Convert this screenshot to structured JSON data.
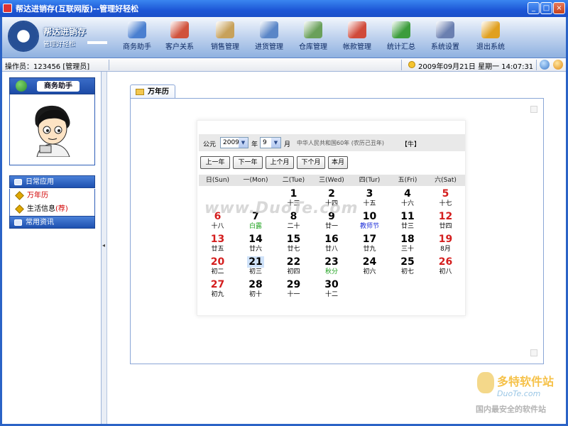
{
  "window": {
    "title": "帮达进销存(互联网版)--管理好轻松",
    "controls": [
      "minimize",
      "maximize",
      "close"
    ]
  },
  "brand": {
    "name": "帮达进销存",
    "slogan": "管理好轻松"
  },
  "toolbar": [
    {
      "label": "商务助手",
      "icon": "assistant-icon",
      "color": "#4a7fd0"
    },
    {
      "label": "客户关系",
      "icon": "customers-icon",
      "color": "#d0523c"
    },
    {
      "label": "销售管理",
      "icon": "sales-icon",
      "color": "#c7a15a"
    },
    {
      "label": "进货管理",
      "icon": "purchase-icon",
      "color": "#5a86c7"
    },
    {
      "label": "仓库管理",
      "icon": "warehouse-icon",
      "color": "#6aa05a"
    },
    {
      "label": "帐款管理",
      "icon": "accounts-icon",
      "color": "#d04a3a"
    },
    {
      "label": "统计汇总",
      "icon": "stats-icon",
      "color": "#3c9c3c"
    },
    {
      "label": "系统设置",
      "icon": "settings-icon",
      "color": "#6a7fb0"
    },
    {
      "label": "退出系统",
      "icon": "exit-icon",
      "color": "#e0a020"
    }
  ],
  "status": {
    "operator": "操作员：123456 [管理员]",
    "datetime": "2009年09月21日 星期一 14:07:31"
  },
  "sidebar": {
    "panel_title": "商务助手",
    "groups": [
      {
        "label": "日常应用",
        "items": [
          {
            "label": "万年历",
            "active": true
          },
          {
            "label": "生活信息",
            "tag": "(荐)"
          }
        ]
      },
      {
        "label": "常用资讯",
        "items": []
      }
    ]
  },
  "content": {
    "tab_label": "万年历",
    "calendar": {
      "prefix": "公元",
      "year": "2009",
      "year_unit": "年",
      "month": "9",
      "month_unit": "月",
      "info": "中华人民共和国60年 (农历己丑年)",
      "zodiac": "【牛】",
      "buttons": [
        "上一年",
        "下一年",
        "上个月",
        "下个月",
        "本月"
      ],
      "weekdays": [
        "日(Sun)",
        "一(Mon)",
        "二(Tue)",
        "三(Wed)",
        "四(Tur)",
        "五(Fri)",
        "六(Sat)"
      ],
      "days": [
        {
          "d": "1",
          "l": "十三"
        },
        {
          "d": "2",
          "l": "十四"
        },
        {
          "d": "3",
          "l": "十五"
        },
        {
          "d": "4",
          "l": "十六"
        },
        {
          "d": "5",
          "l": "十七"
        },
        {
          "d": "6",
          "l": "十八"
        },
        {
          "d": "7",
          "l": "白露"
        },
        {
          "d": "8",
          "l": "二十"
        },
        {
          "d": "9",
          "l": "廿一"
        },
        {
          "d": "10",
          "l": "教师节"
        },
        {
          "d": "11",
          "l": "廿三"
        },
        {
          "d": "12",
          "l": "廿四"
        },
        {
          "d": "13",
          "l": "廿五"
        },
        {
          "d": "14",
          "l": "廿六"
        },
        {
          "d": "15",
          "l": "廿七"
        },
        {
          "d": "16",
          "l": "廿八"
        },
        {
          "d": "17",
          "l": "廿九"
        },
        {
          "d": "18",
          "l": "三十"
        },
        {
          "d": "19",
          "l": "8月"
        },
        {
          "d": "20",
          "l": "初二"
        },
        {
          "d": "21",
          "l": "初三"
        },
        {
          "d": "22",
          "l": "初四"
        },
        {
          "d": "23",
          "l": "秋分"
        },
        {
          "d": "24",
          "l": "初六"
        },
        {
          "d": "25",
          "l": "初七"
        },
        {
          "d": "26",
          "l": "初八"
        },
        {
          "d": "27",
          "l": "初九"
        },
        {
          "d": "28",
          "l": "初十"
        },
        {
          "d": "29",
          "l": "十一"
        },
        {
          "d": "30",
          "l": "十二"
        }
      ]
    }
  },
  "watermarks": {
    "center": "www.DuoTe.com",
    "site_name": "多特软件站",
    "site_url": "DuoTe.com",
    "site_slogan": "国内最安全的软件站"
  }
}
